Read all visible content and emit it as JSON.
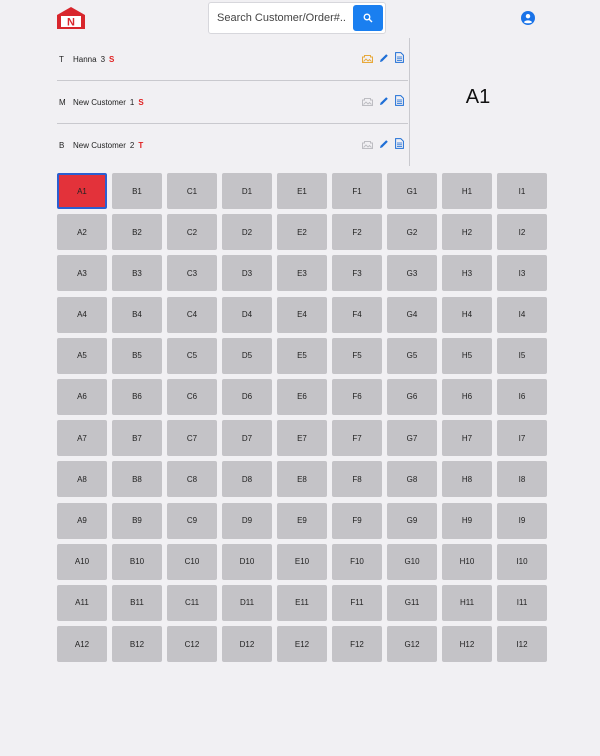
{
  "header": {
    "logo_letter": "N",
    "search_placeholder": "Search Customer/Order#...",
    "icons": {
      "search": "search-icon",
      "user": "account-circle-icon"
    }
  },
  "orders": [
    {
      "letter": "T",
      "name": "Hanna",
      "count": "3",
      "tag": "S",
      "tag_color": "#e02020",
      "icons": [
        "gallery-icon",
        "pencil-icon",
        "document-icon"
      ]
    },
    {
      "letter": "M",
      "name": "New Customer",
      "count": "1",
      "tag": "S",
      "tag_color": "#e02020",
      "icons": [
        "gallery-icon",
        "pencil-icon",
        "document-icon"
      ]
    },
    {
      "letter": "B",
      "name": "New Customer",
      "count": "2",
      "tag": "T",
      "tag_color": "#e02020",
      "icons": [
        "gallery-icon",
        "pencil-icon",
        "document-icon"
      ]
    }
  ],
  "selected_slot": "A1",
  "grid": {
    "columns": [
      "A",
      "B",
      "C",
      "D",
      "E",
      "F",
      "G",
      "H",
      "I"
    ],
    "rows": 12,
    "active_cell": "A1"
  },
  "colors": {
    "background": "#f1f0f3",
    "cell": "#c4c3c7",
    "active_cell": "#e3323a",
    "active_border": "#2b5fd0",
    "accent": "#1a7ff0",
    "tag": "#e02020",
    "gallery_highlight": "#e8a93a"
  }
}
